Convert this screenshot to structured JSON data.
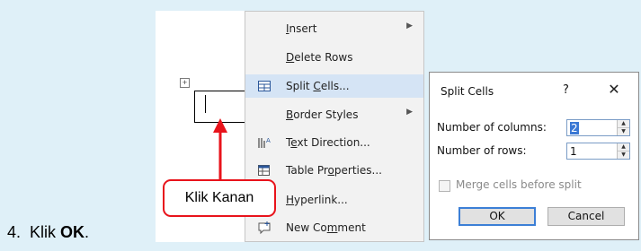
{
  "step": {
    "number": "4.",
    "text_before": "Klik ",
    "bold": "OK",
    "text_after": "."
  },
  "table_handle_icon": "move-cross-icon",
  "context_menu": {
    "items": [
      {
        "label": "Insert",
        "underline_index": 0,
        "icon": "",
        "submenu": true
      },
      {
        "label": "Delete Rows",
        "underline_index": 0,
        "icon": "",
        "submenu": false
      },
      {
        "label": "Split Cells...",
        "underline_index": 6,
        "icon": "split-cells-icon",
        "submenu": false,
        "highlighted": true
      },
      {
        "label": "Border Styles",
        "underline_index": 0,
        "icon": "",
        "submenu": true
      },
      {
        "label": "Text Direction...",
        "underline_index": 1,
        "icon": "text-direction-icon",
        "submenu": false
      },
      {
        "label": "Table Properties...",
        "underline_index": 8,
        "icon": "table-properties-icon",
        "submenu": false
      },
      {
        "label": "Hyperlink...",
        "underline_index": 0,
        "icon": "hyperlink-icon",
        "submenu": false
      },
      {
        "label": "New Comment",
        "underline_index": 6,
        "icon": "new-comment-icon",
        "submenu": false
      }
    ],
    "highlight_color": "#d5e4f5"
  },
  "dialog": {
    "title": "Split Cells",
    "help": "?",
    "close": "✕",
    "columns_label": "Number of columns:",
    "columns_value": "2",
    "rows_label": "Number of rows:",
    "rows_value": "1",
    "merge_label": "Merge cells before split",
    "merge_checked": false,
    "ok_label": "OK",
    "cancel_label": "Cancel"
  },
  "annotation": {
    "text": "Klik Kanan",
    "color": "#e8131b"
  }
}
